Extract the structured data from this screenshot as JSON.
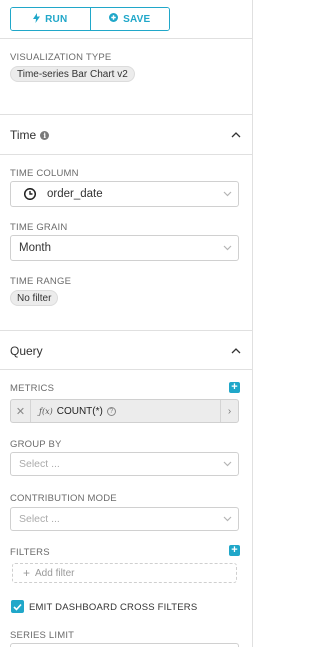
{
  "toolbar": {
    "run_label": "RUN",
    "save_label": "SAVE"
  },
  "viz_type": {
    "label": "VISUALIZATION TYPE",
    "value": "Time-series Bar Chart v2"
  },
  "time_section": {
    "title": "Time",
    "time_column": {
      "label": "TIME COLUMN",
      "value": "order_date"
    },
    "time_grain": {
      "label": "TIME GRAIN",
      "value": "Month"
    },
    "time_range": {
      "label": "TIME RANGE",
      "value": "No filter"
    }
  },
  "query_section": {
    "title": "Query",
    "metrics": {
      "label": "METRICS",
      "item": "COUNT(*)"
    },
    "group_by": {
      "label": "GROUP BY",
      "placeholder": "Select ..."
    },
    "contribution_mode": {
      "label": "CONTRIBUTION MODE",
      "placeholder": "Select ..."
    },
    "filters": {
      "label": "FILTERS",
      "add_label": "Add filter"
    },
    "cross_filters": {
      "label": "EMIT DASHBOARD CROSS FILTERS",
      "checked": true
    },
    "series_limit": {
      "label": "SERIES LIMIT"
    }
  },
  "colors": {
    "accent": "#20a7c9",
    "border": "#d0d0d0",
    "divider": "#e0e0e0"
  }
}
